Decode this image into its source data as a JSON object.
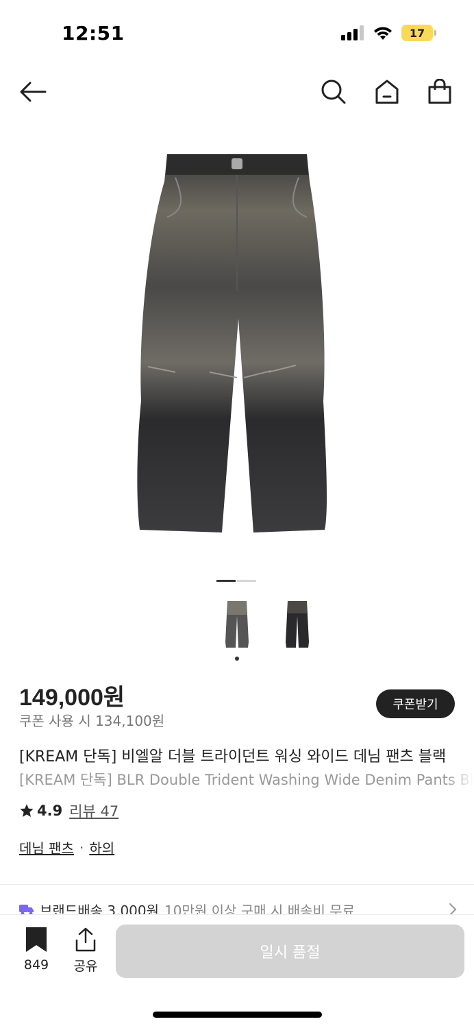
{
  "status": {
    "time": "12:51",
    "battery": "17"
  },
  "product": {
    "price": "149,000원",
    "coupon_price": "쿠폰 사용 시 134,100원",
    "coupon_button": "쿠폰받기",
    "title_ko": "[KREAM 단독] 비엘알 더블 트라이던트 워싱 와이드 데님 팬츠 블랙",
    "title_en": "[KREAM 단독] BLR Double Trident Washing Wide Denim Pants Black",
    "rating": "4.9",
    "review_link": "리뷰 47",
    "category_1": "데님 팬츠",
    "category_sep": "·",
    "category_2": "하의"
  },
  "shipping": {
    "label": "브랜드배송 3,000원",
    "note": "10만원 이상 구매 시 배송비 무료"
  },
  "bottom_bar": {
    "bookmark_count": "849",
    "share_label": "공유",
    "action_label": "일시 품절"
  },
  "gallery": {
    "page_count": 2,
    "current_page": 1
  },
  "icons": [
    "back-arrow-icon",
    "search-icon",
    "home-icon",
    "shopping-bag-icon",
    "star-icon",
    "truck-icon",
    "chevron-right-icon",
    "bookmark-icon",
    "share-icon"
  ],
  "colors": {
    "accent_dark": "#222222",
    "soldout_bg": "#d3d3d3",
    "battery": "#fad85a",
    "truck": "#7b68ee"
  }
}
